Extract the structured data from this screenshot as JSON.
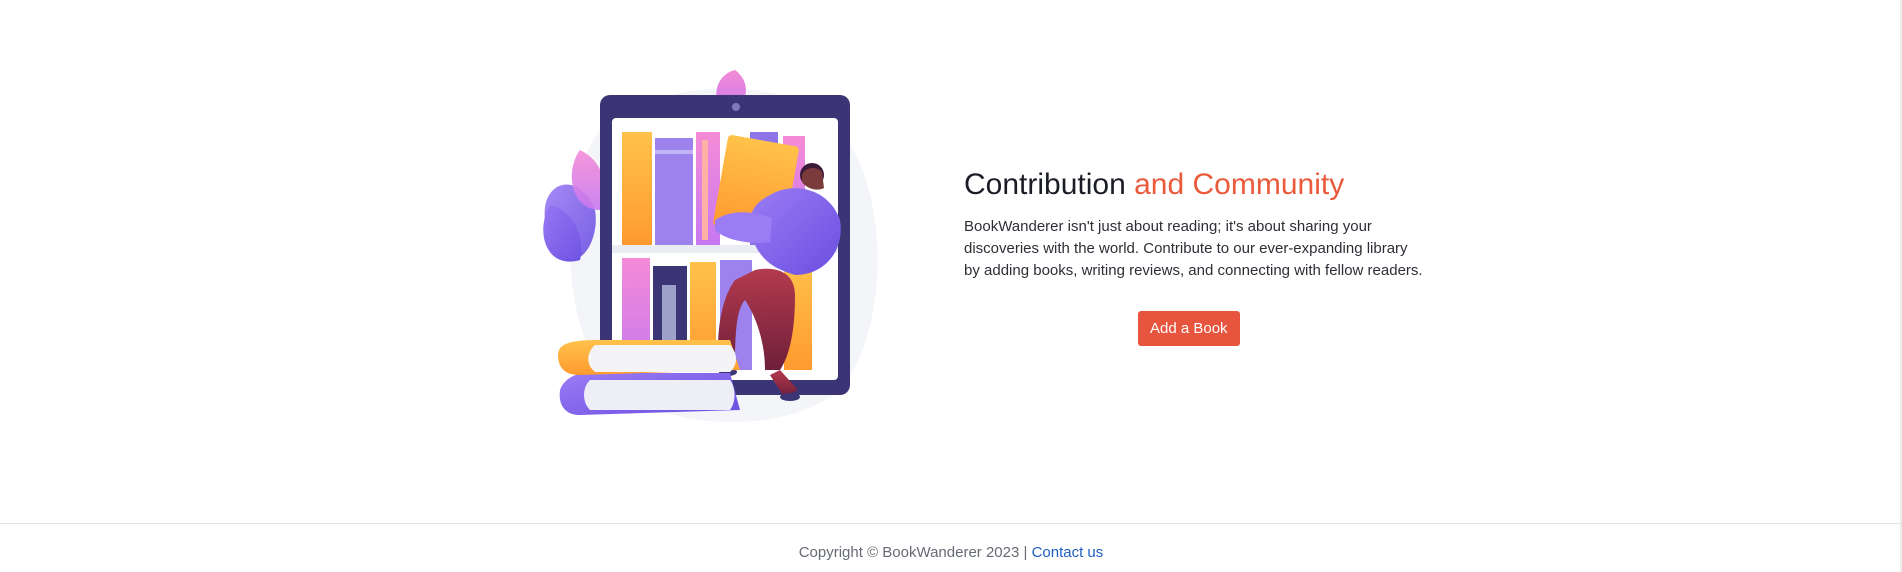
{
  "section": {
    "heading_main": "Contribution",
    "heading_accent": "and Community",
    "description": "BookWanderer isn't just about reading; it's about sharing your discoveries with the world. Contribute to our ever-expanding library by adding books, writing reviews, and connecting with fellow readers.",
    "button_label": "Add a Book",
    "illustration_icon": "reader-bookshelf-illustration"
  },
  "footer": {
    "copyright": "Copyright © BookWanderer 2023 |",
    "contact_label": "Contact us"
  },
  "colors": {
    "accent": "#ea5a3b",
    "button": "#e8553e",
    "link": "#1d5fbf",
    "heading": "#1b1d26"
  }
}
